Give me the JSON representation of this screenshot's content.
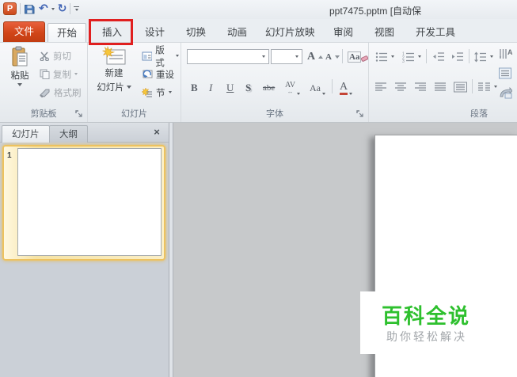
{
  "titlebar": {
    "title": "ppt7475.pptm [自动保",
    "qat": {
      "app_logo": "P"
    }
  },
  "tabs": {
    "file_label": "文件",
    "items": [
      {
        "label": "开始",
        "active": true
      },
      {
        "label": "插入",
        "highlighted": true
      },
      {
        "label": "设计"
      },
      {
        "label": "切换"
      },
      {
        "label": "动画"
      },
      {
        "label": "幻灯片放映"
      },
      {
        "label": "审阅"
      },
      {
        "label": "视图"
      },
      {
        "label": "开发工具"
      }
    ]
  },
  "ribbon": {
    "clipboard": {
      "group_label": "剪贴板",
      "paste_label": "粘贴",
      "cut_label": "剪切",
      "copy_label": "复制",
      "format_painter_label": "格式刷"
    },
    "slides": {
      "group_label": "幻灯片",
      "new_slide_line1": "新建",
      "new_slide_line2": "幻灯片",
      "layout_label": "版式",
      "reset_label": "重设",
      "section_label": "节"
    },
    "font": {
      "group_label": "字体",
      "bold": "B",
      "italic": "I",
      "underline": "U",
      "shadow": "S",
      "strikethrough": "abe",
      "char_spacing": "AV",
      "change_case": "Aa",
      "grow_font": "A",
      "shrink_font": "A",
      "clear_format": "Aa",
      "font_color": "A"
    },
    "paragraph": {
      "group_label": "段落"
    }
  },
  "sidebar": {
    "slides_tab": "幻灯片",
    "outline_tab": "大纲",
    "close_glyph": "×",
    "slide_number": "1"
  },
  "watermark": {
    "title": "百科全说",
    "subtitle": "助你轻松解决"
  },
  "colors": {
    "file_tab": "#D14518",
    "annotation_box": "#E01F1F",
    "watermark_green": "#2EC02E",
    "canvas_gray": "#C7C9CB",
    "slide_bg": "#FFFFFF"
  }
}
